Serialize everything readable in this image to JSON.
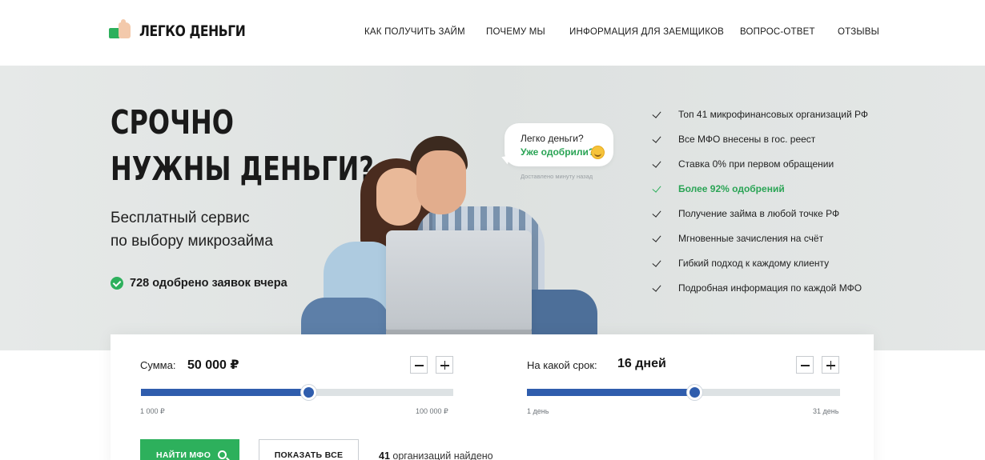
{
  "brand": {
    "name": "ЛЕГКО ДЕНЬГИ",
    "accent": "#2db05c",
    "slider_color": "#2f5dad"
  },
  "nav": [
    {
      "label": "КАК ПОЛУЧИТЬ ЗАЙМ"
    },
    {
      "label": "ПОЧЕМУ МЫ"
    },
    {
      "label": "ИНФОРМАЦИЯ ДЛЯ ЗАЕМЩИКОВ"
    },
    {
      "label": "ВОПРОС-ОТВЕТ"
    },
    {
      "label": "ОТЗЫВЫ"
    }
  ],
  "hero": {
    "title_line1": "СРОЧНО",
    "title_line2": "НУЖНЫ ДЕНЬГИ?",
    "subtitle_line1": "Бесплатный сервис",
    "subtitle_line2": "по выбору микрозайма",
    "approved_text": "728 одобрено заявок вчера"
  },
  "bubble": {
    "line1": "Легко деньги?",
    "line2": "Уже одобрили?",
    "time": "Доставлено минуту назад",
    "icon": "smile-icon"
  },
  "features": [
    {
      "text": "Топ 41 микрофинансовых организаций РФ",
      "highlight": false
    },
    {
      "text": "Все МФО внесены в гос. реест",
      "highlight": false
    },
    {
      "text": "Ставка 0% при первом обращении",
      "highlight": false
    },
    {
      "text": "Более 92% одобрений",
      "highlight": true
    },
    {
      "text": "Получение займа в любой точке РФ",
      "highlight": false
    },
    {
      "text": "Мгновенные зачисления на счёт",
      "highlight": false
    },
    {
      "text": "Гибкий подход к каждому клиенту",
      "highlight": false
    },
    {
      "text": "Подробная информация по каждой МФО",
      "highlight": false
    }
  ],
  "calculator": {
    "amount": {
      "label": "Сумма:",
      "value": "50 000 ₽",
      "min_label": "1 000 ₽",
      "max_label": "100 000 ₽",
      "level": 0.535
    },
    "term": {
      "label": "На какой срок:",
      "value": "16 дней",
      "min_label": "1 день",
      "max_label": "31 день",
      "level": 0.535
    },
    "find_button": "НАЙТИ МФО",
    "show_all_button": "ПОКАЗАТЬ ВСЕ",
    "found_count": "41",
    "found_text": "организаций найдено"
  }
}
